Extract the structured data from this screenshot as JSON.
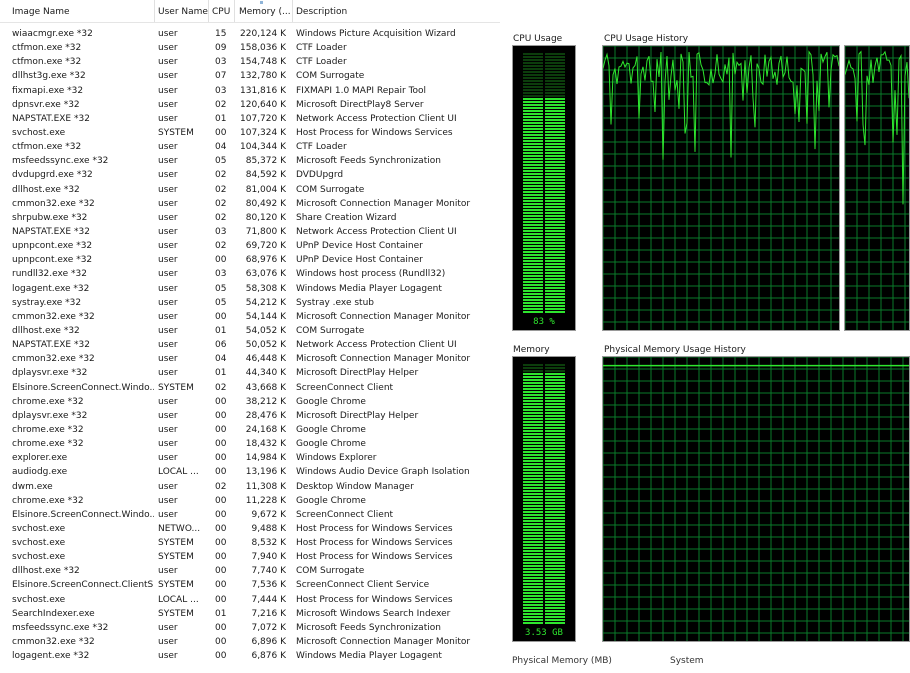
{
  "table": {
    "headers": {
      "name": "Image Name",
      "user": "User Name",
      "cpu": "CPU",
      "memory": "Memory (...",
      "desc": "Description"
    },
    "rows": [
      {
        "name": "wiaacmgr.exe *32",
        "user": "user",
        "cpu": "15",
        "mem": "220,124 K",
        "desc": "Windows Picture Acquisition Wizard"
      },
      {
        "name": "ctfmon.exe *32",
        "user": "user",
        "cpu": "09",
        "mem": "158,036 K",
        "desc": "CTF Loader"
      },
      {
        "name": "ctfmon.exe *32",
        "user": "user",
        "cpu": "03",
        "mem": "154,748 K",
        "desc": "CTF Loader"
      },
      {
        "name": "dllhst3g.exe *32",
        "user": "user",
        "cpu": "07",
        "mem": "132,780 K",
        "desc": "COM Surrogate"
      },
      {
        "name": "fixmapi.exe *32",
        "user": "user",
        "cpu": "03",
        "mem": "131,816 K",
        "desc": "FIXMAPI 1.0 MAPI Repair Tool"
      },
      {
        "name": "dpnsvr.exe *32",
        "user": "user",
        "cpu": "02",
        "mem": "120,640 K",
        "desc": "Microsoft DirectPlay8 Server"
      },
      {
        "name": "NAPSTAT.EXE *32",
        "user": "user",
        "cpu": "01",
        "mem": "107,720 K",
        "desc": "Network Access Protection Client UI"
      },
      {
        "name": "svchost.exe",
        "user": "SYSTEM",
        "cpu": "00",
        "mem": "107,324 K",
        "desc": "Host Process for Windows Services"
      },
      {
        "name": "ctfmon.exe *32",
        "user": "user",
        "cpu": "04",
        "mem": "104,344 K",
        "desc": "CTF Loader"
      },
      {
        "name": "msfeedssync.exe *32",
        "user": "user",
        "cpu": "05",
        "mem": "85,372 K",
        "desc": "Microsoft Feeds Synchronization"
      },
      {
        "name": "dvdupgrd.exe *32",
        "user": "user",
        "cpu": "02",
        "mem": "84,592 K",
        "desc": "DVDUpgrd"
      },
      {
        "name": "dllhost.exe *32",
        "user": "user",
        "cpu": "02",
        "mem": "81,004 K",
        "desc": "COM Surrogate"
      },
      {
        "name": "cmmon32.exe *32",
        "user": "user",
        "cpu": "02",
        "mem": "80,492 K",
        "desc": "Microsoft Connection Manager Monitor"
      },
      {
        "name": "shrpubw.exe *32",
        "user": "user",
        "cpu": "02",
        "mem": "80,120 K",
        "desc": "Share Creation Wizard"
      },
      {
        "name": "NAPSTAT.EXE *32",
        "user": "user",
        "cpu": "03",
        "mem": "71,800 K",
        "desc": "Network Access Protection Client UI"
      },
      {
        "name": "upnpcont.exe *32",
        "user": "user",
        "cpu": "02",
        "mem": "69,720 K",
        "desc": "UPnP Device Host Container"
      },
      {
        "name": "upnpcont.exe *32",
        "user": "user",
        "cpu": "00",
        "mem": "68,976 K",
        "desc": "UPnP Device Host Container"
      },
      {
        "name": "rundll32.exe *32",
        "user": "user",
        "cpu": "03",
        "mem": "63,076 K",
        "desc": "Windows host process (Rundll32)"
      },
      {
        "name": "logagent.exe *32",
        "user": "user",
        "cpu": "05",
        "mem": "58,308 K",
        "desc": "Windows Media Player Logagent"
      },
      {
        "name": "systray.exe *32",
        "user": "user",
        "cpu": "05",
        "mem": "54,212 K",
        "desc": "Systray .exe stub"
      },
      {
        "name": "cmmon32.exe *32",
        "user": "user",
        "cpu": "00",
        "mem": "54,144 K",
        "desc": "Microsoft Connection Manager Monitor"
      },
      {
        "name": "dllhost.exe *32",
        "user": "user",
        "cpu": "01",
        "mem": "54,052 K",
        "desc": "COM Surrogate"
      },
      {
        "name": "NAPSTAT.EXE *32",
        "user": "user",
        "cpu": "06",
        "mem": "50,052 K",
        "desc": "Network Access Protection Client UI"
      },
      {
        "name": "cmmon32.exe *32",
        "user": "user",
        "cpu": "04",
        "mem": "46,448 K",
        "desc": "Microsoft Connection Manager Monitor"
      },
      {
        "name": "dplaysvr.exe *32",
        "user": "user",
        "cpu": "01",
        "mem": "44,340 K",
        "desc": "Microsoft DirectPlay Helper"
      },
      {
        "name": "Elsinore.ScreenConnect.Windo...",
        "user": "SYSTEM",
        "cpu": "02",
        "mem": "43,668 K",
        "desc": "ScreenConnect Client"
      },
      {
        "name": "chrome.exe *32",
        "user": "user",
        "cpu": "00",
        "mem": "38,212 K",
        "desc": "Google Chrome"
      },
      {
        "name": "dplaysvr.exe *32",
        "user": "user",
        "cpu": "00",
        "mem": "28,476 K",
        "desc": "Microsoft DirectPlay Helper"
      },
      {
        "name": "chrome.exe *32",
        "user": "user",
        "cpu": "00",
        "mem": "24,168 K",
        "desc": "Google Chrome"
      },
      {
        "name": "chrome.exe *32",
        "user": "user",
        "cpu": "00",
        "mem": "18,432 K",
        "desc": "Google Chrome"
      },
      {
        "name": "explorer.exe",
        "user": "user",
        "cpu": "00",
        "mem": "14,984 K",
        "desc": "Windows Explorer"
      },
      {
        "name": "audiodg.exe",
        "user": "LOCAL ...",
        "cpu": "00",
        "mem": "13,196 K",
        "desc": "Windows Audio Device Graph Isolation"
      },
      {
        "name": "dwm.exe",
        "user": "user",
        "cpu": "02",
        "mem": "11,308 K",
        "desc": "Desktop Window Manager"
      },
      {
        "name": "chrome.exe *32",
        "user": "user",
        "cpu": "00",
        "mem": "11,228 K",
        "desc": "Google Chrome"
      },
      {
        "name": "Elsinore.ScreenConnect.Windo...",
        "user": "user",
        "cpu": "00",
        "mem": "9,672 K",
        "desc": "ScreenConnect Client"
      },
      {
        "name": "svchost.exe",
        "user": "NETWO...",
        "cpu": "00",
        "mem": "9,488 K",
        "desc": "Host Process for Windows Services"
      },
      {
        "name": "svchost.exe",
        "user": "SYSTEM",
        "cpu": "00",
        "mem": "8,532 K",
        "desc": "Host Process for Windows Services"
      },
      {
        "name": "svchost.exe",
        "user": "SYSTEM",
        "cpu": "00",
        "mem": "7,940 K",
        "desc": "Host Process for Windows Services"
      },
      {
        "name": "dllhost.exe *32",
        "user": "user",
        "cpu": "00",
        "mem": "7,740 K",
        "desc": "COM Surrogate"
      },
      {
        "name": "Elsinore.ScreenConnect.ClientS...",
        "user": "SYSTEM",
        "cpu": "00",
        "mem": "7,536 K",
        "desc": "ScreenConnect Client Service"
      },
      {
        "name": "svchost.exe",
        "user": "LOCAL ...",
        "cpu": "00",
        "mem": "7,444 K",
        "desc": "Host Process for Windows Services"
      },
      {
        "name": "SearchIndexer.exe",
        "user": "SYSTEM",
        "cpu": "01",
        "mem": "7,216 K",
        "desc": "Microsoft Windows Search Indexer"
      },
      {
        "name": "msfeedssync.exe *32",
        "user": "user",
        "cpu": "00",
        "mem": "7,072 K",
        "desc": "Microsoft Feeds Synchronization"
      },
      {
        "name": "cmmon32.exe *32",
        "user": "user",
        "cpu": "00",
        "mem": "6,896 K",
        "desc": "Microsoft Connection Manager Monitor"
      },
      {
        "name": "logagent.exe *32",
        "user": "user",
        "cpu": "00",
        "mem": "6,876 K",
        "desc": "Windows Media Player Logagent"
      }
    ]
  },
  "performance": {
    "cpu_usage_label": "CPU Usage",
    "cpu_history_label": "CPU Usage History",
    "cpu_usage_value": "83 %",
    "cpu_usage_fraction": 0.83,
    "memory_label": "Memory",
    "memory_history_label": "Physical Memory Usage History",
    "memory_value": "3.53 GB",
    "memory_fraction": 0.97,
    "physical_memory_label": "Physical Memory (MB)",
    "system_label": "System",
    "colors": {
      "graph_bg": "#000000",
      "grid": "#0a7a2a",
      "line": "#2ee62e",
      "bar_on": "#2ee62e",
      "bar_off": "#0c3d0c"
    }
  }
}
